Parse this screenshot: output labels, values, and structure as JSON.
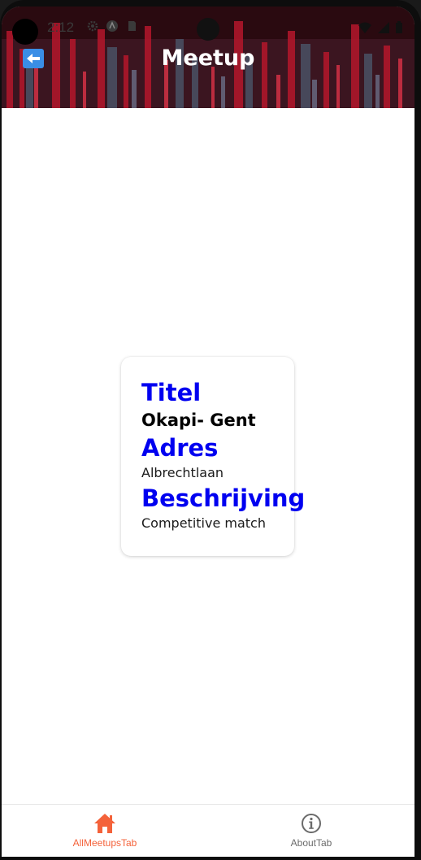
{
  "status_bar": {
    "time": "2:12"
  },
  "header": {
    "title": "Meetup",
    "back_icon": "left-arrow-icon",
    "back_color": "#3a8ee6"
  },
  "card": {
    "title_label": "Titel",
    "title_value": "Okapi- Gent",
    "address_label": "Adres",
    "address_value": "Albrechtlaan",
    "description_label": "Beschrijving",
    "description_value": "Competitive match",
    "label_color": "#0000f0"
  },
  "tabbar": {
    "tabs": [
      {
        "label": "AllMeetupsTab",
        "icon": "home-icon",
        "active": true,
        "color": "#f4623a"
      },
      {
        "label": "AboutTab",
        "icon": "info-icon",
        "active": false,
        "color": "#6b6b6b"
      }
    ]
  }
}
